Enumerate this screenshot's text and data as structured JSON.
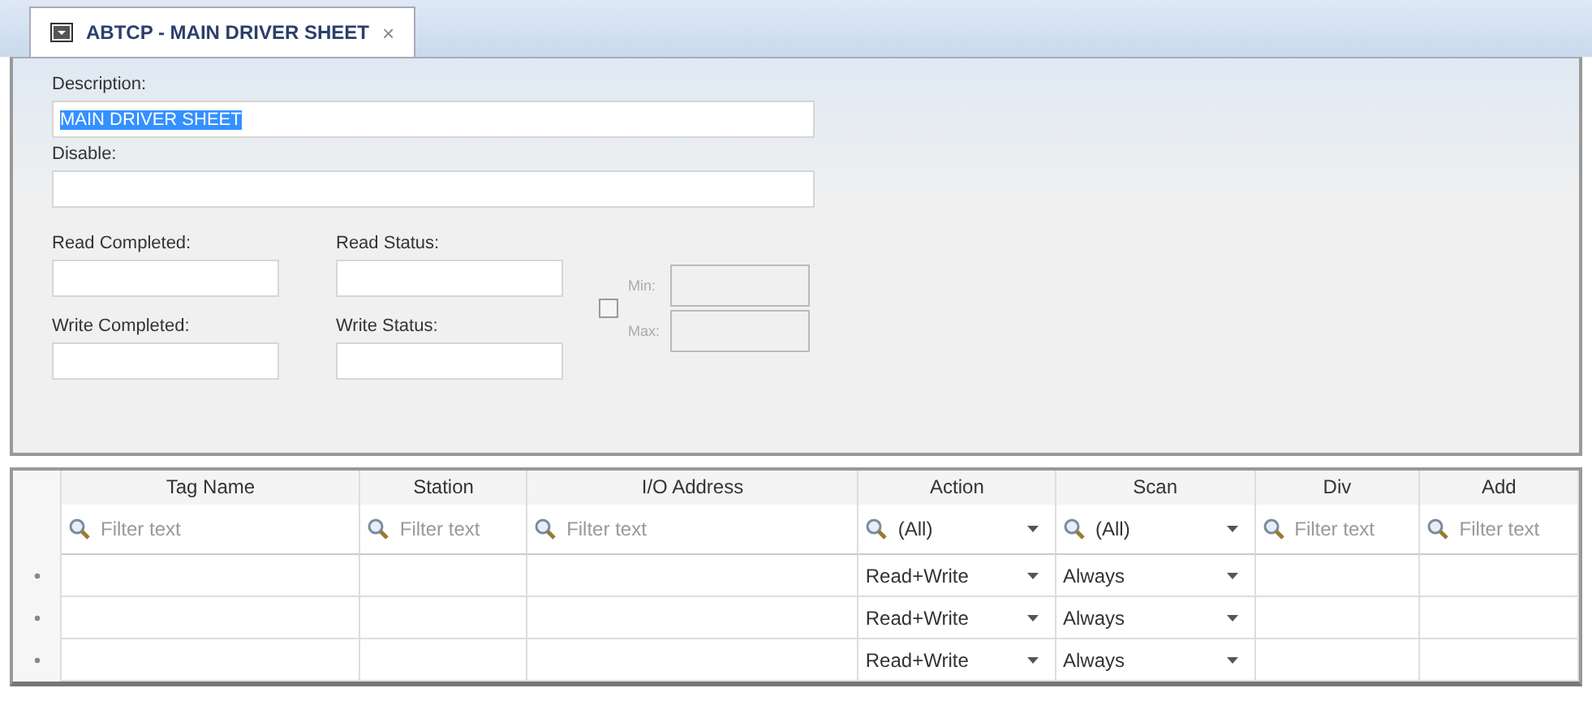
{
  "tab": {
    "title": "ABTCP - MAIN DRIVER SHEET",
    "close": "×",
    "selected": true
  },
  "form": {
    "description": {
      "label": "Description:",
      "value": "MAIN DRIVER SHEET",
      "selected": true
    },
    "disable": {
      "label": "Disable:"
    },
    "read_completed": {
      "label": "Read Completed:"
    },
    "read_status": {
      "label": "Read Status:"
    },
    "write_completed": {
      "label": "Write Completed:"
    },
    "write_status": {
      "label": "Write Status:"
    },
    "range": {
      "checked": false,
      "disabled": true,
      "min_label": "Min:",
      "max_label": "Max:"
    }
  },
  "grid": {
    "columns": [
      {
        "title": "Tag Name",
        "filter": {
          "kind": "text",
          "placeholder": "Filter text"
        }
      },
      {
        "title": "Station",
        "filter": {
          "kind": "text",
          "placeholder": "Filter text"
        }
      },
      {
        "title": "I/O Address",
        "filter": {
          "kind": "text",
          "placeholder": "Filter text"
        }
      },
      {
        "title": "Action",
        "filter": {
          "kind": "dropdown",
          "value": "(All)"
        }
      },
      {
        "title": "Scan",
        "filter": {
          "kind": "dropdown",
          "value": "(All)"
        }
      },
      {
        "title": "Div",
        "filter": {
          "kind": "text",
          "placeholder": "Filter text"
        }
      },
      {
        "title": "Add",
        "filter": {
          "kind": "text",
          "placeholder": "Filter text"
        }
      }
    ],
    "rows": [
      {
        "action": "Read+Write",
        "scan": "Always"
      },
      {
        "action": "Read+Write",
        "scan": "Always"
      },
      {
        "action": "Read+Write",
        "scan": "Always"
      }
    ]
  }
}
